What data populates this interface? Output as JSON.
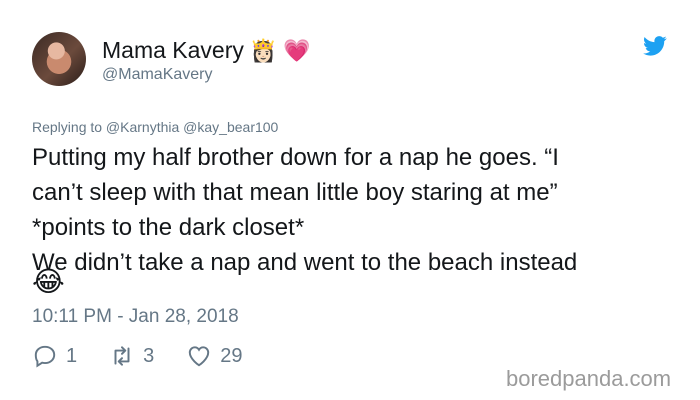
{
  "user": {
    "display_name": "Mama Kavery",
    "name_emojis": [
      "👸🏻",
      "💗"
    ],
    "handle": "@MamaKavery"
  },
  "icons": {
    "brand": "twitter-bird-icon",
    "brand_color": "#1da1f2"
  },
  "reply_context": "Replying to @Karnythia @kay_bear100",
  "tweet": {
    "lines": [
      "Putting my half brother down for a nap he goes. “I",
      "can’t sleep with that mean little boy staring at me”",
      "*points to the dark closet*",
      "We didn’t take a nap and went to the beach instead"
    ],
    "emoji": "😂"
  },
  "timestamp": "10:11 PM - Jan 28, 2018",
  "actions": {
    "replies": "1",
    "retweets": "3",
    "likes": "29"
  },
  "watermark": "boredpanda.com"
}
